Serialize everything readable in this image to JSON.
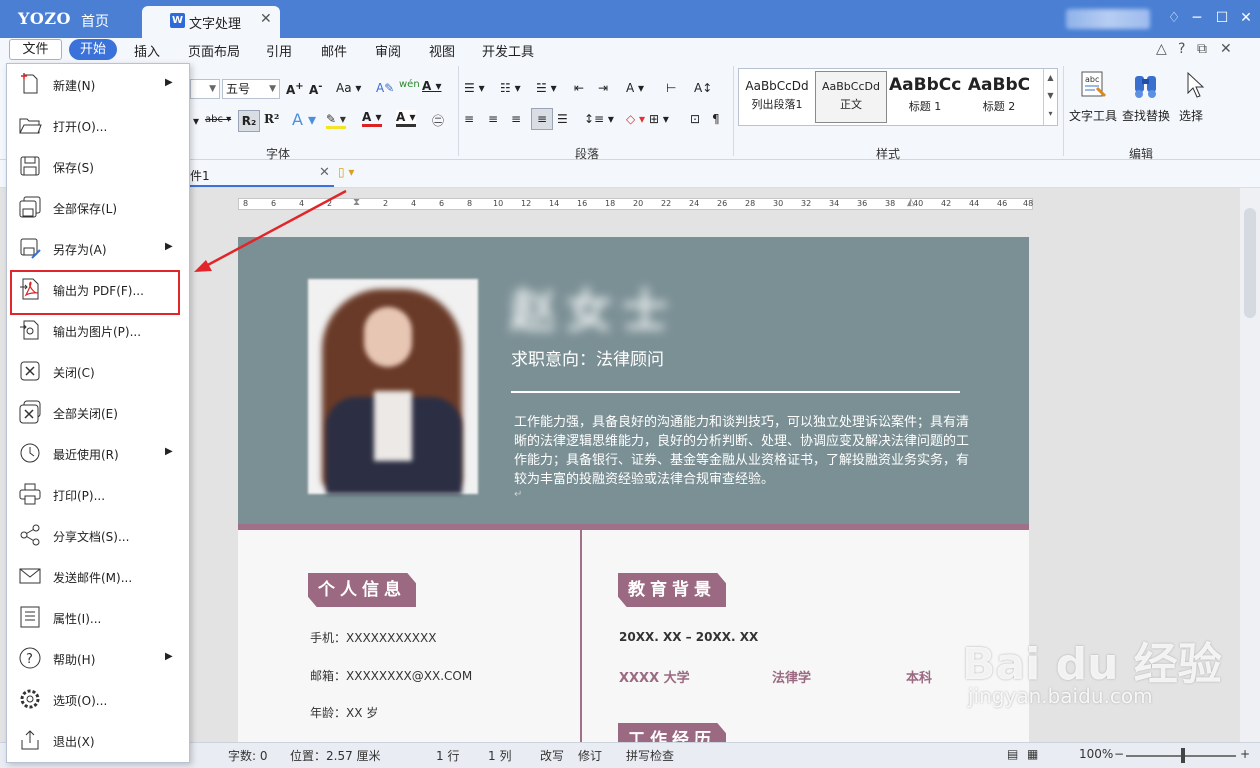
{
  "titlebar": {
    "logo": "YOZO",
    "home_tab": "首页",
    "doc_tab": "文字处理",
    "doc_tab_icon": "W"
  },
  "menubar": {
    "file": "文件",
    "tabs": [
      "开始",
      "插入",
      "页面布局",
      "引用",
      "邮件",
      "审阅",
      "视图",
      "开发工具"
    ]
  },
  "ribbon": {
    "font_size": "五号",
    "group_font": "字体",
    "group_paragraph": "段落",
    "group_style": "样式",
    "group_edit": "编辑",
    "styles": [
      {
        "sample": "AaBbCcDd",
        "name": "列出段落1"
      },
      {
        "sample": "AaBbCcDd",
        "name": "正文"
      },
      {
        "sample": "AaBbCc",
        "name": "标题 1"
      },
      {
        "sample": "AaBbC",
        "name": "标题 2"
      }
    ],
    "text_tool": "文字工具",
    "find_replace": "查找替换",
    "select": "选择"
  },
  "docbar": {
    "doc_name": "件1"
  },
  "file_menu": {
    "items": [
      {
        "label": "新建(N)",
        "icon": "new-doc-icon",
        "submenu": true
      },
      {
        "label": "打开(O)...",
        "icon": "open-folder-icon",
        "submenu": false
      },
      {
        "label": "保存(S)",
        "icon": "save-icon",
        "submenu": false
      },
      {
        "label": "全部保存(L)",
        "icon": "save-all-icon",
        "submenu": false
      },
      {
        "label": "另存为(A)",
        "icon": "save-as-icon",
        "submenu": true
      },
      {
        "label": "输出为 PDF(F)...",
        "icon": "pdf-icon",
        "submenu": false
      },
      {
        "label": "输出为图片(P)...",
        "icon": "export-image-icon",
        "submenu": false
      },
      {
        "label": "关闭(C)",
        "icon": "close-doc-icon",
        "submenu": false
      },
      {
        "label": "全部关闭(E)",
        "icon": "close-all-icon",
        "submenu": false
      },
      {
        "label": "最近使用(R)",
        "icon": "recent-clock-icon",
        "submenu": true
      },
      {
        "label": "打印(P)...",
        "icon": "printer-icon",
        "submenu": false
      },
      {
        "label": "分享文档(S)...",
        "icon": "share-icon",
        "submenu": false
      },
      {
        "label": "发送邮件(M)...",
        "icon": "mail-icon",
        "submenu": false
      },
      {
        "label": "属性(I)...",
        "icon": "properties-icon",
        "submenu": false
      },
      {
        "label": "帮助(H)",
        "icon": "help-icon",
        "submenu": true
      },
      {
        "label": "选项(O)...",
        "icon": "options-gear-icon",
        "submenu": false
      },
      {
        "label": "退出(X)",
        "icon": "exit-icon",
        "submenu": false
      }
    ]
  },
  "ruler": {
    "ticks": [
      "8",
      "6",
      "4",
      "2",
      "2",
      "4",
      "6",
      "8",
      "10",
      "12",
      "14",
      "16",
      "18",
      "20",
      "22",
      "24",
      "26",
      "28",
      "30",
      "32",
      "34",
      "36",
      "38",
      "40",
      "42",
      "44",
      "46",
      "48"
    ]
  },
  "document": {
    "name": "赵女士",
    "intent": "求职意向：法律顾问",
    "summary": "工作能力强，具备良好的沟通能力和谈判技巧，可以独立处理诉讼案件；具有清晰的法律逻辑思维能力，良好的分析判断、处理、协调应变及解决法律问题的工作能力；具备银行、证券、基金等金融从业资格证书，了解投融资业务实务，有较为丰富的投融资经验或法律合规审查经验。",
    "personal_title": "个人信息",
    "phone": "手机：XXXXXXXXXXX",
    "email": "邮箱：XXXXXXXX@XX.COM",
    "age": "年龄：XX 岁",
    "edu_title": "教育背景",
    "edu_period": "20XX. XX – 20XX. XX",
    "school": "XXXX 大学",
    "major": "法律学",
    "degree": "本科",
    "work_title": "工作经历"
  },
  "status": {
    "words": "字数: 0",
    "position": "位置：2.57 厘米",
    "line": "1 行",
    "column": "1 列",
    "overwrite": "改写",
    "track": "修订",
    "spell": "拼写检查",
    "zoom": "100%"
  },
  "watermark": {
    "logo": "Bai du 经验",
    "url": "jingyan.baidu.com"
  },
  "colors": {
    "titlebar": "#4a7fd3",
    "accent_mauve": "#9b6a82",
    "header_band": "#7b9095",
    "highlight_red": "#e0262a"
  }
}
